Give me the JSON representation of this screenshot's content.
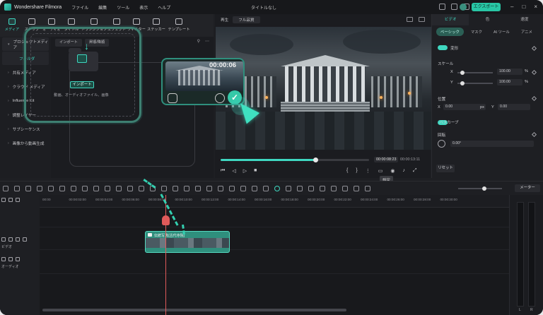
{
  "app": {
    "name": "Wondershare Filmora",
    "title": "タイトルなし",
    "export": "エクスポート"
  },
  "menu": [
    "ファイル",
    "編集",
    "ツール",
    "表示",
    "ヘルプ"
  ],
  "media_tabs": [
    "メディア",
    "ストック",
    "オーディオ",
    "タイトル",
    "トランジション",
    "エフェクト",
    "フィルター",
    "ステッカー",
    "テンプレート"
  ],
  "sidebar": {
    "items": [
      {
        "label": "プロジェクトメディア"
      },
      {
        "label": "フォルダ"
      },
      {
        "label": "共有メディア"
      },
      {
        "label": "クラウド メディア"
      },
      {
        "label": "Influence Kit"
      },
      {
        "label": "調整レイヤー"
      },
      {
        "label": "サブシーケンス"
      },
      {
        "label": "画像から動画生成"
      }
    ]
  },
  "media_toolbar": {
    "import": "インポート",
    "sort": "昇順/降順"
  },
  "dropzone": {
    "import_button": "インポート",
    "hint": "動画、オーディオファイル、画像"
  },
  "drag_card": {
    "duration": "00:00:06"
  },
  "player": {
    "label": "再生",
    "quality": "フル品質",
    "current_time": "00:00:08:23",
    "total_time": "00:00:13:11",
    "tooltip": "設定"
  },
  "props": {
    "tabs": [
      "ビデオ",
      "色",
      "速度"
    ],
    "subtabs": [
      "ベーシック",
      "マスク",
      "AI ツール",
      "アニメ"
    ],
    "transform": "変形",
    "scale": "スケール",
    "x_label": "X",
    "y_label": "Y",
    "scale_x": "100.00",
    "scale_y": "100.00",
    "percent": "%",
    "position": "位置",
    "pos_x": "0.00",
    "pos_y": "0.00",
    "px": "px",
    "bg": "バスカーブ",
    "rotate": "回転",
    "rotate_val": "0.00°",
    "reset": "リセット"
  },
  "timeline": {
    "ticks": [
      "00:00",
      "00:00:02:00",
      "00:00:04:00",
      "00:00:06:00",
      "00:00:08:00",
      "00:00:10:00",
      "00:00:12:00",
      "00:00:14:00",
      "00:00:16:00",
      "00:00:18:00",
      "00:00:20:00",
      "00:00:22:00",
      "00:00:24:00",
      "00:00:26:00",
      "00:00:28:00",
      "00:00:30:00"
    ],
    "video_track": "ビデオ",
    "audio_track": "オーディオ",
    "clip_label": "伝統写真(古代寺院)",
    "meter": "メーター",
    "meter_l": "L",
    "meter_r": "R"
  }
}
